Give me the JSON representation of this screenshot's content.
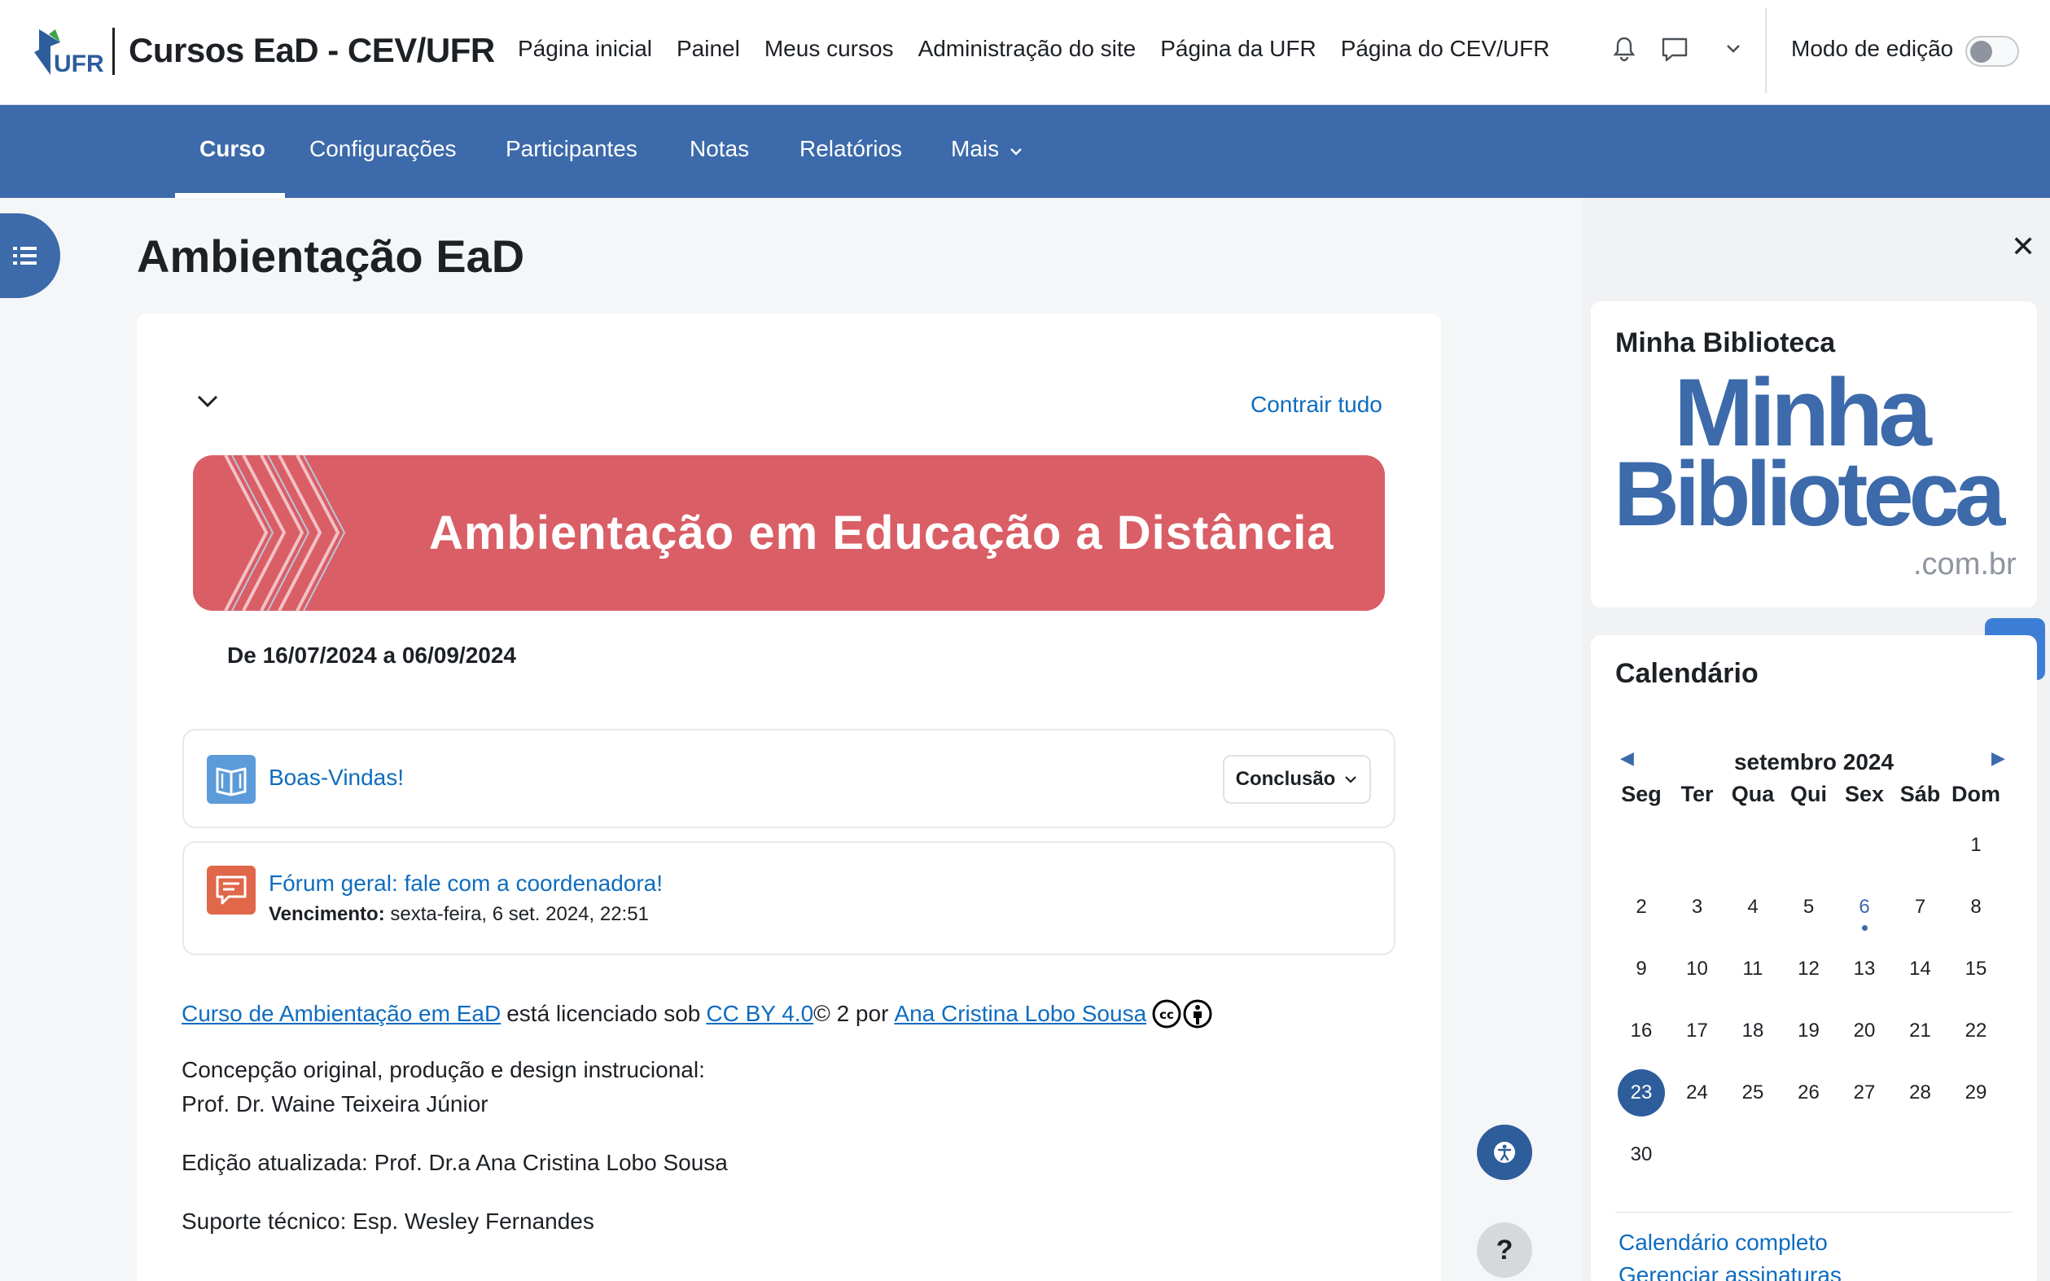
{
  "header": {
    "site_name": "Cursos EaD - CEV/UFR",
    "logo_text": "UFR",
    "nav": [
      "Página inicial",
      "Painel",
      "Meus cursos",
      "Administração do site",
      "Página da UFR",
      "Página do CEV/UFR"
    ],
    "edit_mode_label": "Modo de edição",
    "edit_mode_on": false
  },
  "course_nav": {
    "tabs": [
      "Curso",
      "Configurações",
      "Participantes",
      "Notas",
      "Relatórios",
      "Mais"
    ],
    "active": "Curso"
  },
  "page": {
    "title": "Ambientação EaD",
    "collapse_all": "Contrair tudo",
    "banner_title": "Ambientação em Educação a Distância",
    "dates": "De 16/07/2024 a 06/09/2024",
    "activities": [
      {
        "title": "Boas-Vindas!",
        "type": "book",
        "completion_label": "Conclusão"
      },
      {
        "title": "Fórum geral: fale com a coordenadora!",
        "type": "forum",
        "due_label": "Vencimento:",
        "due_value": "sexta-feira, 6 set. 2024, 22:51"
      }
    ],
    "license": {
      "work": "Curso de Ambientação em EaD",
      "licensed_text": "está licenciado sob",
      "license_name": "CC BY 4.0",
      "copyright_text": "© 2 por",
      "author": "Ana Cristina Lobo Sousa"
    },
    "credits": {
      "line1": "Concepção original, produção e design instrucional:",
      "line2": "Prof. Dr. Waine Teixeira Júnior",
      "line3": "Edição atualizada: Prof. Dr.a Ana Cristina Lobo Sousa",
      "line4": "Suporte técnico: Esp. Wesley Fernandes"
    }
  },
  "floating": {
    "help": "?"
  },
  "drawer": {
    "library_block": {
      "title": "Minha Biblioteca",
      "logo_line1": "Minha",
      "logo_line2": "Biblioteca",
      "logo_line3": ".com.br"
    },
    "calendar": {
      "title": "Calendário",
      "month": "setembro 2024",
      "weekdays": [
        "Seg",
        "Ter",
        "Qua",
        "Qui",
        "Sex",
        "Sáb",
        "Dom"
      ],
      "weeks": [
        [
          "",
          "",
          "",
          "",
          "",
          "",
          "1"
        ],
        [
          "2",
          "3",
          "4",
          "5",
          "6",
          "7",
          "8"
        ],
        [
          "9",
          "10",
          "11",
          "12",
          "13",
          "14",
          "15"
        ],
        [
          "16",
          "17",
          "18",
          "19",
          "20",
          "21",
          "22"
        ],
        [
          "23",
          "24",
          "25",
          "26",
          "27",
          "28",
          "29"
        ],
        [
          "30",
          "",
          "",
          "",
          "",
          "",
          ""
        ]
      ],
      "today": "23",
      "event_days": [
        "6"
      ],
      "full_link": "Calendário completo",
      "subscriptions_link": "Gerenciar assinaturas"
    }
  },
  "colors": {
    "brand": "#3c6aaa",
    "banner": "#da5e66",
    "link": "#0f6cbf"
  }
}
